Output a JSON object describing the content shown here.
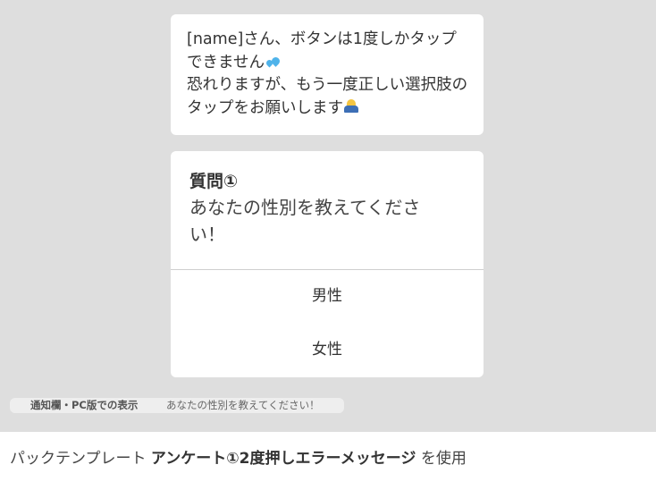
{
  "message_bubble": {
    "line1": "[name]さん、ボタンは1度しかタップ",
    "line2": "できません",
    "line3": "恐れりますが、もう一度正しい選択肢の",
    "line4": "タップをお願いします",
    "line2_icon": "sweat-droplets-icon",
    "line4_icon": "person-bowing-icon"
  },
  "survey": {
    "label": "質問①",
    "question": "あなたの性別を教えてください！",
    "options": [
      "男性",
      "女性"
    ]
  },
  "notification_preview": {
    "label": "通知欄・PC版での表示",
    "text": "あなたの性別を教えてください！"
  },
  "footer": {
    "prefix": "パックテンプレート ",
    "template_name": "アンケート①2度押しエラーメッセージ",
    "suffix": " を使用"
  },
  "colors": {
    "preview_background": "#dedede",
    "bubble_background": "#ffffff",
    "text": "#333333"
  }
}
